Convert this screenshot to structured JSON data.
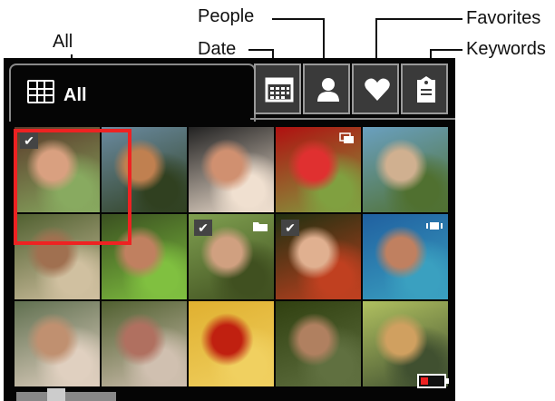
{
  "callouts": {
    "all": "All",
    "date": "Date",
    "people": "People",
    "favorites": "Favorites",
    "keywords": "Keywords"
  },
  "tabs": {
    "all_label": "All"
  },
  "thumbnails": [
    {
      "colors": [
        "#5a3a2a",
        "#d9a080",
        "#88aa60"
      ],
      "checked": true
    },
    {
      "colors": [
        "#6a8aa0",
        "#c08050",
        "#304020"
      ],
      "checked": false
    },
    {
      "colors": [
        "#222222",
        "#d09070",
        "#f0e0d0"
      ],
      "checked": false
    },
    {
      "colors": [
        "#b01010",
        "#e03030",
        "#80a040"
      ],
      "checked": false,
      "corner": "stack"
    },
    {
      "colors": [
        "#6aa0c0",
        "#d0b090",
        "#507030"
      ],
      "checked": false
    },
    {
      "colors": [
        "#506030",
        "#a07050",
        "#d0c0a0"
      ],
      "checked": false
    },
    {
      "colors": [
        "#3a5020",
        "#c08060",
        "#80c040"
      ],
      "checked": false
    },
    {
      "colors": [
        "#80a050",
        "#d0a080",
        "#405020"
      ],
      "checked": true,
      "corner": "folder"
    },
    {
      "colors": [
        "#203010",
        "#e0b090",
        "#c04020"
      ],
      "checked": true
    },
    {
      "colors": [
        "#2060a0",
        "#c08060",
        "#3aa0c0"
      ],
      "checked": false,
      "corner": "video"
    },
    {
      "colors": [
        "#607050",
        "#c09070",
        "#e0d0c0"
      ],
      "checked": false
    },
    {
      "colors": [
        "#506030",
        "#b07060",
        "#d0c0b0"
      ],
      "checked": false
    },
    {
      "colors": [
        "#e0b030",
        "#c02010",
        "#f0d060"
      ],
      "checked": false
    },
    {
      "colors": [
        "#304010",
        "#b08060",
        "#607040"
      ],
      "checked": false
    },
    {
      "colors": [
        "#b0c060",
        "#d0a060",
        "#405030"
      ],
      "checked": false
    }
  ]
}
